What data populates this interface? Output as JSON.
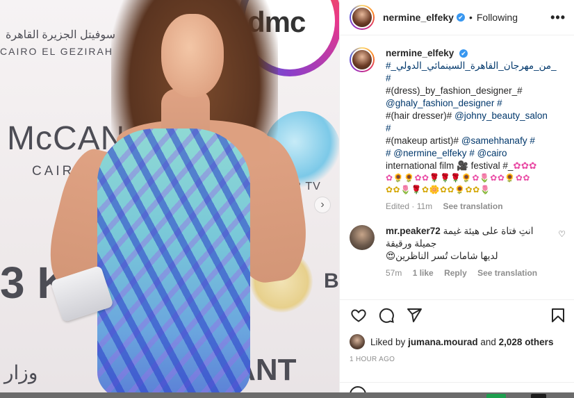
{
  "post": {
    "username": "nermine_elfeky",
    "verified_mark": "✔",
    "separator": "•",
    "follow_status": "Following",
    "more_label": "•••",
    "background_text": {
      "arabic_top": "سوفيتل الجزيرة القاهرة",
      "cairo_el_gezirah": "CAIRO EL GEZIRAH",
      "mccann": "McCAN",
      "cairo": "CAIRO",
      "dmc": "dmc",
      "tv": "AR TV",
      "red_letters": "3 K",
      "b_letter": "B",
      "arabic_bottom": "وزار",
      "vant": "VANT"
    },
    "next_arrow": "›"
  },
  "caption": {
    "username": "nermine_elfeky",
    "lines": [
      "#_من_مهرجان_القاهرة_السينمائي_الدولي_",
      "#",
      "#(dress)_by_fashion_designer_#",
      "@ghaly_fashion_designer",
      "#",
      "#(hair dresser)#",
      "@johny_beauty_salon",
      "#",
      "#(makeup artist)#",
      "@samehhanafy",
      "#",
      "#",
      "@nermine_elfeky",
      "#",
      "@cairo",
      "international film 🎥 festival #_",
      "✿✿✿",
      "✿🌻🌻✿✿🌹🌹🌹🌻✿🌷✿✿🌻✿✿",
      "✿✿🌷🌹✿🌼✿✿🌻✿✿🌷"
    ],
    "edited": "Edited · 11m",
    "see_translation": "See translation"
  },
  "comment": {
    "username": "mr.peaker72",
    "text_line1": "انتِ فتاة على هيئة غيمة",
    "text_line2": "جميلة ورقيقة",
    "text_line3": "لديها شامات تُسر الناظرين",
    "emoji": "😍",
    "time": "57m",
    "likes": "1 like",
    "reply": "Reply",
    "see_translation": "See translation",
    "like_icon": "♡"
  },
  "actions": {
    "like": "heart-icon",
    "comment": "comment-icon",
    "share": "share-icon",
    "save": "bookmark-icon"
  },
  "likes": {
    "prefix": "Liked by",
    "liker": "jumana.mourad",
    "and": "and",
    "others": "2,028 others"
  },
  "timestamp": "1 HOUR AGO",
  "colors": {
    "link": "#00376b",
    "verified": "#3897f0",
    "muted": "#8e8e8e",
    "text": "#262626"
  }
}
